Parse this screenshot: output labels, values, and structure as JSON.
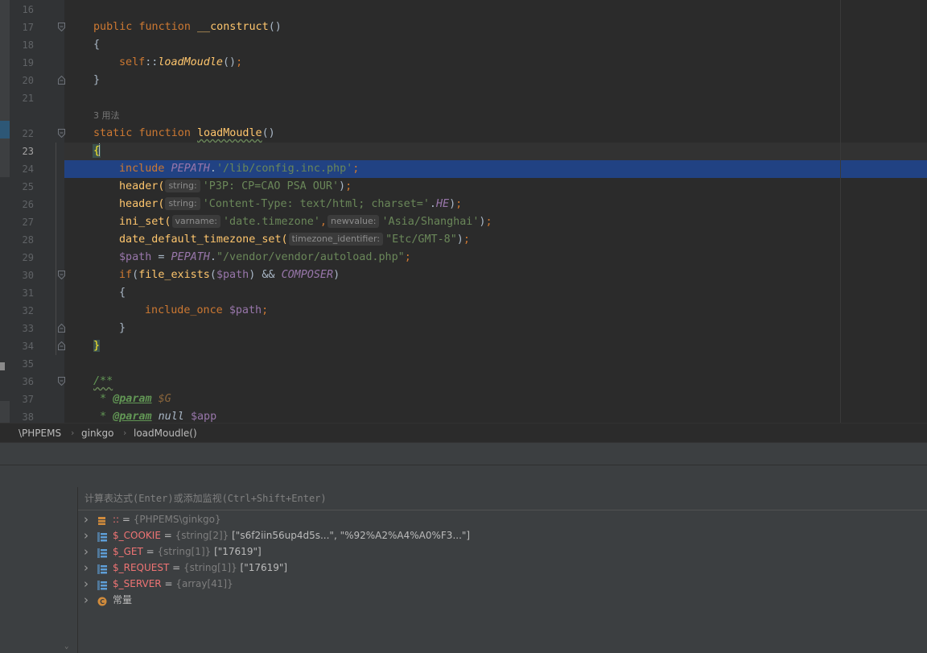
{
  "editor": {
    "lines": [
      {
        "num": "16"
      },
      {
        "num": "17",
        "t1": "public",
        "t2": "function",
        "t3": "__construct",
        "t4": "()"
      },
      {
        "num": "18",
        "t1": "{"
      },
      {
        "num": "19",
        "t1": "self",
        "t2": "::",
        "t3": "loadMoudle",
        "t4": "()",
        "t5": ";"
      },
      {
        "num": "20",
        "t1": "}"
      },
      {
        "num": "21"
      },
      {
        "num": "22",
        "t1": "static",
        "t2": "function",
        "t3": "loadMoudle",
        "t4": "()"
      },
      {
        "num": "23",
        "t1": "{"
      },
      {
        "num": "24",
        "t1": "include",
        "t2": "PEPATH",
        "t3": ".",
        "t4": "'/lib/config.inc.php'",
        "t5": ";"
      },
      {
        "num": "25",
        "t1": "header(",
        "hint": "string:",
        "t2": "'P3P: CP=CAO PSA OUR'",
        "t3": ")",
        "t4": ";"
      },
      {
        "num": "26",
        "t1": "header(",
        "hint": "string:",
        "t2": "'Content-Type: text/html; charset='",
        "t3": ".",
        "t4": "HE",
        "t5": ")",
        "t6": ";"
      },
      {
        "num": "27",
        "t1": "ini_set(",
        "hint": "varname:",
        "t2": "'date.timezone'",
        "t3": ",",
        "hint2": "newvalue:",
        "t4": "'Asia/Shanghai'",
        "t5": ")",
        "t6": ";"
      },
      {
        "num": "28",
        "t1": "date_default_timezone_set(",
        "hint": "timezone_identifier:",
        "t2": "\"Etc/GMT-8\"",
        "t3": ")",
        "t4": ";"
      },
      {
        "num": "29",
        "t1": "$path",
        "t2": " = ",
        "t3": "PEPATH",
        "t4": ".",
        "t5": "\"/vendor/vendor/autoload.php\"",
        "t6": ";"
      },
      {
        "num": "30",
        "t1": "if",
        "t2": "(",
        "t3": "file_exists",
        "t4": "(",
        "t5": "$path",
        "t6": ") && ",
        "t7": "COMPOSER",
        "t8": ")"
      },
      {
        "num": "31",
        "t1": "{"
      },
      {
        "num": "32",
        "t1": "include_once",
        "t2": "$path",
        "t3": ";"
      },
      {
        "num": "33",
        "t1": "}"
      },
      {
        "num": "34",
        "t1": "}"
      },
      {
        "num": "35"
      },
      {
        "num": "36",
        "t1": "/**"
      },
      {
        "num": "37",
        "t1": " * ",
        "t2": "@param",
        "t3": "$G"
      },
      {
        "num": "38",
        "t1": " * ",
        "t2": "@param",
        "t3": "null",
        "t4": "$app"
      }
    ],
    "usage_hint": "3 用法"
  },
  "breadcrumb": [
    "\\PHPEMS",
    "ginkgo",
    "loadMoudle()"
  ],
  "debugger": {
    "eval_placeholder": "计算表达式(Enter)或添加监视(Ctrl+Shift+Enter)",
    "variables": [
      {
        "name": "::",
        "eq": " = ",
        "type": "{PHPEMS\\ginkgo}",
        "value": "",
        "icon": "object-icon",
        "plain": false
      },
      {
        "name": "$_COOKIE",
        "eq": " = ",
        "type": "{string[2]}",
        "value": " [\"s6f2iin56up4d5s...\", \"%92%A2%A4%A0%F3...\"]",
        "icon": "array-icon",
        "plain": false
      },
      {
        "name": "$_GET",
        "eq": " = ",
        "type": "{string[1]}",
        "value": " [\"17619\"]",
        "icon": "array-icon",
        "plain": false
      },
      {
        "name": "$_REQUEST",
        "eq": " = ",
        "type": "{string[1]}",
        "value": " [\"17619\"]",
        "icon": "array-icon",
        "plain": false
      },
      {
        "name": "$_SERVER",
        "eq": " = ",
        "type": "{array[41]}",
        "value": "",
        "icon": "array-icon",
        "plain": false
      },
      {
        "name": "常量",
        "eq": "",
        "type": "",
        "value": "",
        "icon": "constant-icon",
        "plain": true
      }
    ]
  },
  "colors": {
    "background": "#2b2b2b",
    "selection": "#214283",
    "keyword": "#cc7832",
    "function": "#ffc66d",
    "string": "#6a8759",
    "constant": "#9876aa"
  }
}
